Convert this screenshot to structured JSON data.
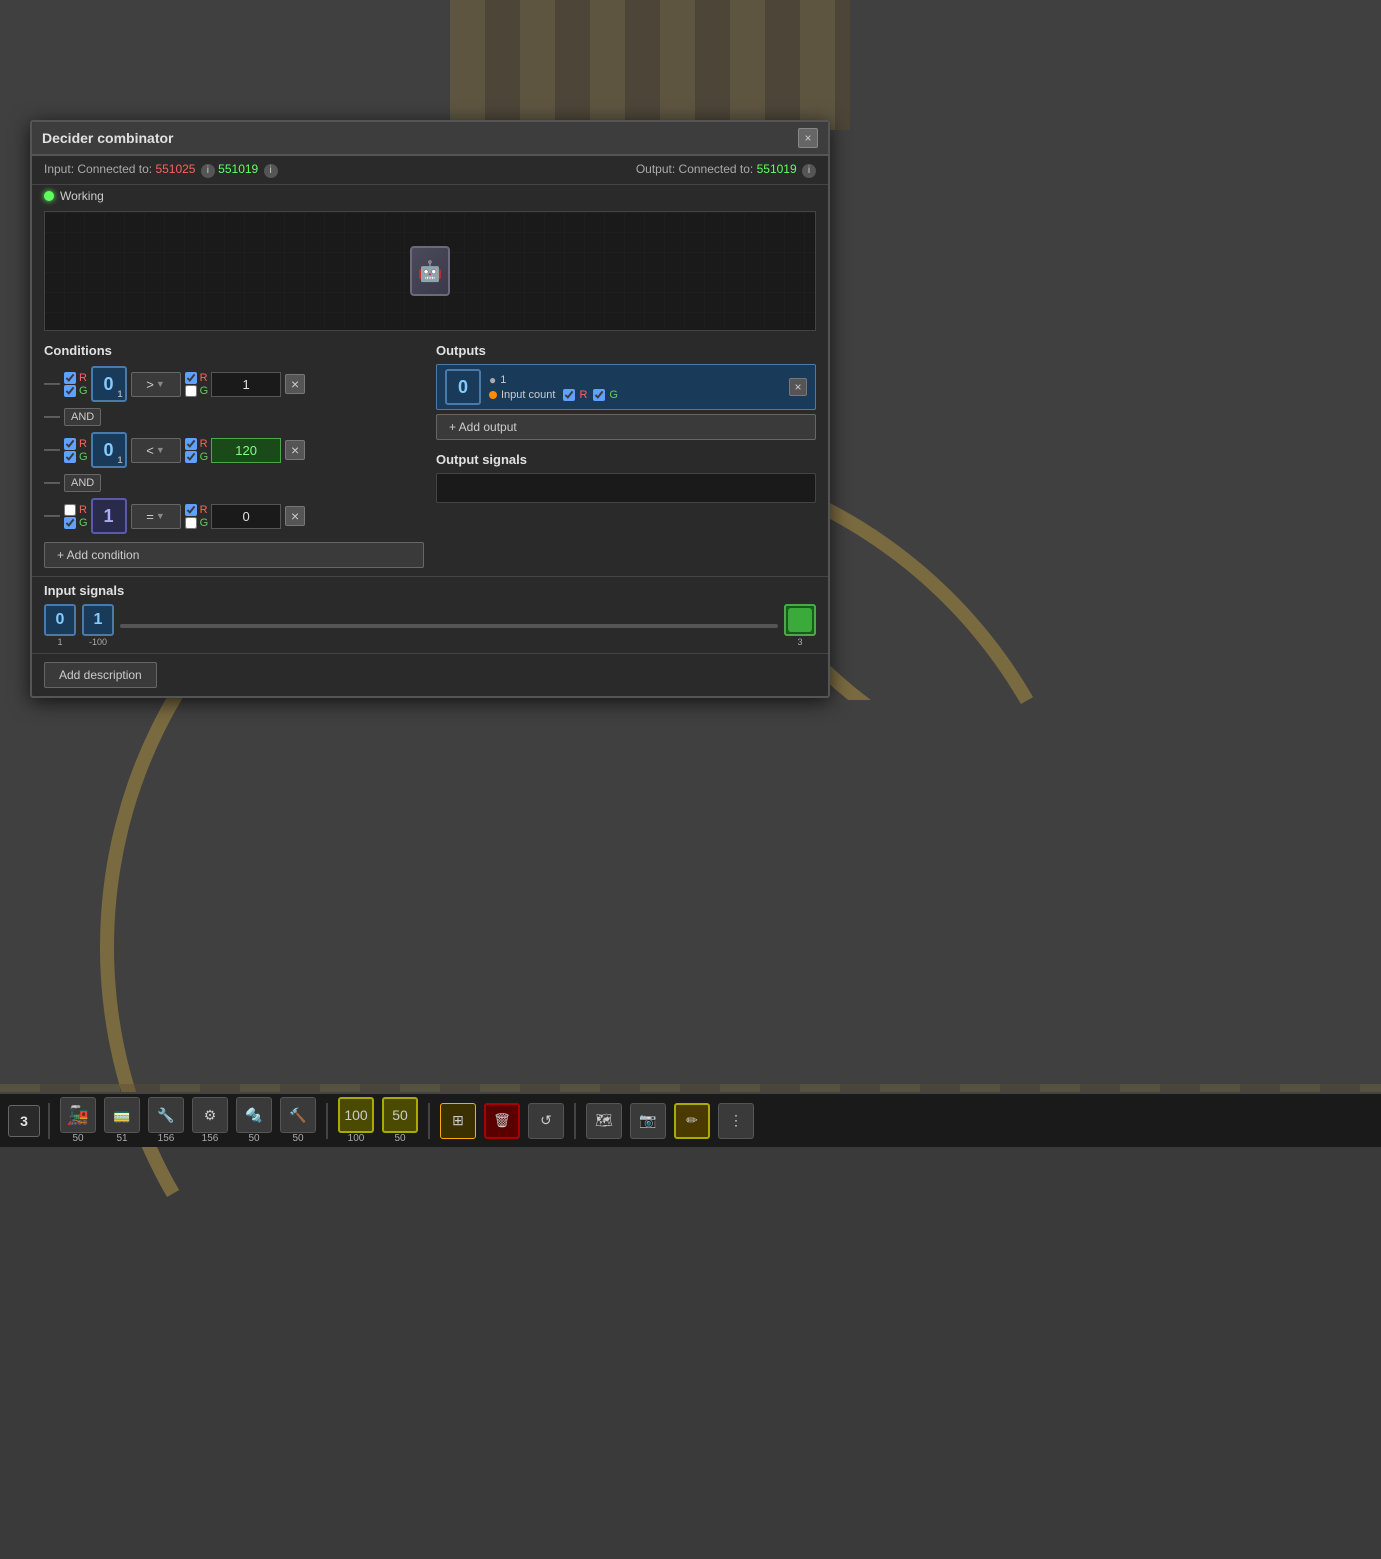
{
  "game": {
    "bg_color": "#3a3a3a"
  },
  "modal": {
    "title": "Decider combinator",
    "close_label": "×",
    "input_label": "Input:",
    "input_connected_label": "Connected to:",
    "input_node1": "551025",
    "input_node2": "551019",
    "output_label": "Output:",
    "output_connected_label": "Connected to:",
    "output_node1": "551019",
    "status": "Working",
    "conditions_title": "Conditions",
    "outputs_title": "Outputs",
    "input_signals_title": "Input signals",
    "output_signals_title": "Output signals",
    "add_condition_label": "+ Add condition",
    "add_output_label": "+ Add output",
    "add_description_label": "Add description"
  },
  "conditions": [
    {
      "id": "cond1",
      "signal_r_checked": true,
      "signal_g_checked": true,
      "signal_value": "0",
      "signal_sub": "1",
      "operator": "> >",
      "right_r_checked": true,
      "right_g_checked": false,
      "right_value": "1",
      "has_and": true
    },
    {
      "id": "cond2",
      "signal_r_checked": true,
      "signal_g_checked": true,
      "signal_value": "0",
      "signal_sub": "1",
      "operator": "< >",
      "right_r_checked": true,
      "right_g_checked": true,
      "right_value": "120",
      "highlight": true,
      "has_and": true
    },
    {
      "id": "cond3",
      "signal_r_checked": false,
      "signal_g_checked": true,
      "signal_value": "1",
      "signal_sub": "",
      "operator": "= >",
      "right_r_checked": true,
      "right_g_checked": false,
      "right_value": "0",
      "has_and": false
    }
  ],
  "outputs": [
    {
      "id": "out1",
      "value": "0",
      "number": "1",
      "input_count": true,
      "input_count_label": "Input count",
      "r_checked": true,
      "g_checked": true
    }
  ],
  "input_signals": [
    {
      "value": "0",
      "sub": "1",
      "type": "blue"
    },
    {
      "value": "1",
      "sub": "-100",
      "type": "blue"
    },
    {
      "value": "3",
      "sub": "",
      "type": "green"
    }
  ],
  "taskbar": {
    "page_num": "3",
    "items": [
      {
        "icon": "🚂",
        "count": "50"
      },
      {
        "icon": "🚃",
        "count": "51"
      },
      {
        "icon": "🔧",
        "count": "156"
      },
      {
        "icon": "⚙",
        "count": "156"
      },
      {
        "icon": "🔩",
        "count": "50"
      },
      {
        "icon": "🔨",
        "count": "50"
      }
    ]
  }
}
